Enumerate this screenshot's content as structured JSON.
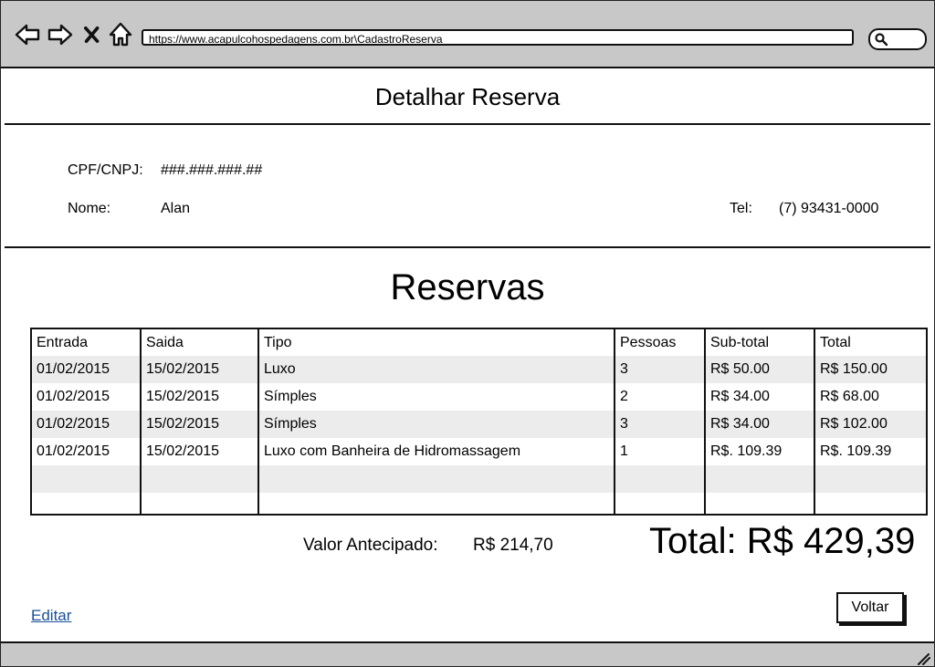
{
  "browser": {
    "url": "https://www.acapulcohospedagens.com.br\\CadastroReserva",
    "icons": [
      "back-icon",
      "forward-icon",
      "close-icon",
      "home-icon",
      "search-icon"
    ]
  },
  "page": {
    "title": "Detalhar Reserva"
  },
  "client": {
    "cpf_label": "CPF/CNPJ:",
    "cpf_value": "###.###.###.##",
    "name_label": "Nome:",
    "name_value": "Alan",
    "tel_label": "Tel:",
    "tel_value": "(7) 93431-0000"
  },
  "reservations": {
    "title": "Reservas",
    "headers": [
      "Entrada",
      "Saida",
      "Tipo",
      "Pessoas",
      "Sub-total",
      "Total"
    ],
    "rows": [
      [
        "01/02/2015",
        "15/02/2015",
        "Luxo",
        "3",
        "R$ 50.00",
        "R$ 150.00"
      ],
      [
        "01/02/2015",
        "15/02/2015",
        "Símples",
        "2",
        "R$ 34.00",
        "R$ 68.00"
      ],
      [
        "01/02/2015",
        "15/02/2015",
        "Símples",
        "3",
        "R$ 34.00",
        "R$ 102.00"
      ],
      [
        "01/02/2015",
        "15/02/2015",
        "Luxo com Banheira de Hidromassagem",
        "1",
        "R$. 109.39",
        "R$. 109.39"
      ],
      [
        "",
        "",
        "",
        "",
        "",
        ""
      ],
      [
        "",
        "",
        "",
        "",
        "",
        ""
      ]
    ]
  },
  "summary": {
    "advance_label": "Valor Antecipado:",
    "advance_value": "R$ 214,70",
    "total": "Total: R$ 429,39"
  },
  "actions": {
    "edit_label": "Editar",
    "back_label": "Voltar"
  }
}
